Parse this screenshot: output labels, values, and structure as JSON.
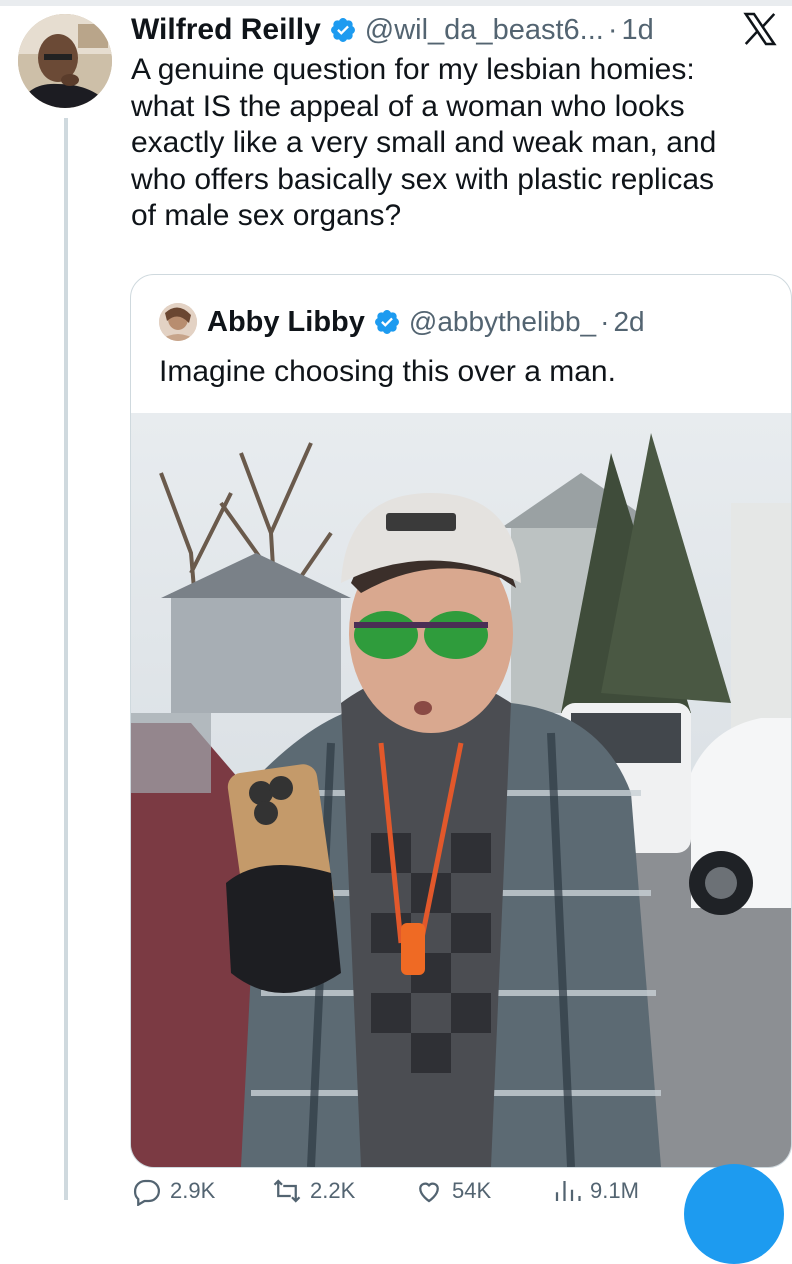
{
  "tweet": {
    "author_name": "Wilfred Reilly",
    "handle": "@wil_da_beast6...",
    "separator": "·",
    "time": "1d",
    "text_lines": [
      "A genuine question for my lesbian homies:",
      "what IS the appeal of a woman who looks",
      "exactly like a very small and weak man, and",
      "who offers basically sex with plastic replicas",
      "of male sex organs?"
    ],
    "verified_icon": "verified-badge-icon",
    "close_icon": "x-logo-icon"
  },
  "quote": {
    "author_name": "Abby Libby",
    "handle": "@abbythelibb_",
    "separator": "·",
    "time": "2d",
    "text": "Imagine choosing this over a man."
  },
  "actions": {
    "reply_count": "2.9K",
    "repost_count": "2.2K",
    "like_count": "54K",
    "views_count": "9.1M"
  },
  "colors": {
    "text": "#0f1419",
    "secondary": "#536471",
    "verified": "#1d9bf0",
    "border": "#cfd9de",
    "accent": "#1d9bf0"
  }
}
